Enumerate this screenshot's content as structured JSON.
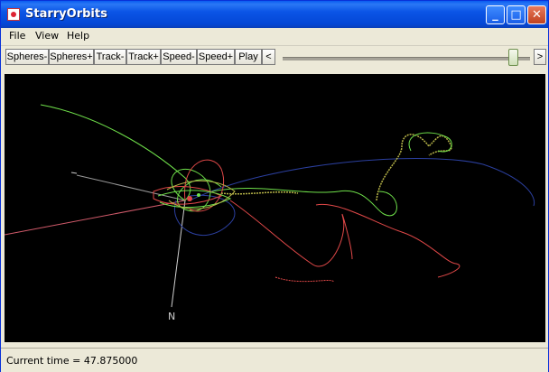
{
  "window": {
    "title": "StarryOrbits"
  },
  "titlebar_buttons": {
    "minimize": "_",
    "maximize": "□",
    "close": "✕"
  },
  "menu": {
    "items": [
      "File",
      "View",
      "Help"
    ]
  },
  "toolbar": {
    "buttons": [
      "Spheres-",
      "Spheres+",
      "Track-",
      "Track+",
      "Speed-",
      "Speed+",
      "Play",
      "<"
    ],
    "next_label": ">",
    "slider_fraction": 0.95
  },
  "canvas": {
    "axis_label": "N",
    "colors": {
      "background": "#000000",
      "green": "#6fe04a",
      "red": "#e04848",
      "blue": "#2b3f9e",
      "olive": "#b7b448",
      "white": "#cfcfcf"
    }
  },
  "status": {
    "text": "Current time = 47.875000"
  }
}
